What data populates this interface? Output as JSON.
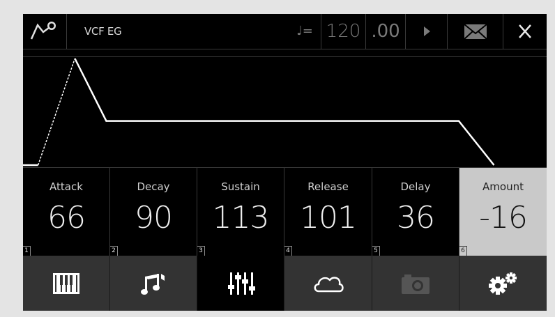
{
  "header": {
    "title": "VCF EG",
    "tempo_note": "♩=",
    "tempo_int": "120",
    "tempo_frac": ".00",
    "icons": [
      "envelope-logo-icon",
      "play-icon",
      "mail-icon",
      "close-icon"
    ]
  },
  "envelope": {
    "attack": 66,
    "decay": 90,
    "sustain": 113,
    "release": 101,
    "delay": 36,
    "amount": -16
  },
  "params": [
    {
      "label": "Attack",
      "value": "66",
      "index": "1"
    },
    {
      "label": "Decay",
      "value": "90",
      "index": "2"
    },
    {
      "label": "Sustain",
      "value": "113",
      "index": "3"
    },
    {
      "label": "Release",
      "value": "101",
      "index": "4"
    },
    {
      "label": "Delay",
      "value": "36",
      "index": "5"
    },
    {
      "label": "Amount",
      "value": "-16",
      "index": "6",
      "selected": true
    }
  ],
  "nav": [
    {
      "icon": "piano-icon"
    },
    {
      "icon": "music-notes-icon"
    },
    {
      "icon": "sliders-icon",
      "active": true
    },
    {
      "icon": "cloud-icon"
    },
    {
      "icon": "camera-icon",
      "disabled": true
    },
    {
      "icon": "gears-icon"
    }
  ],
  "colors": {
    "background": "#000000",
    "panel": "#333333",
    "selected_param": "#c9c9c9",
    "curve": "#ffffff"
  }
}
